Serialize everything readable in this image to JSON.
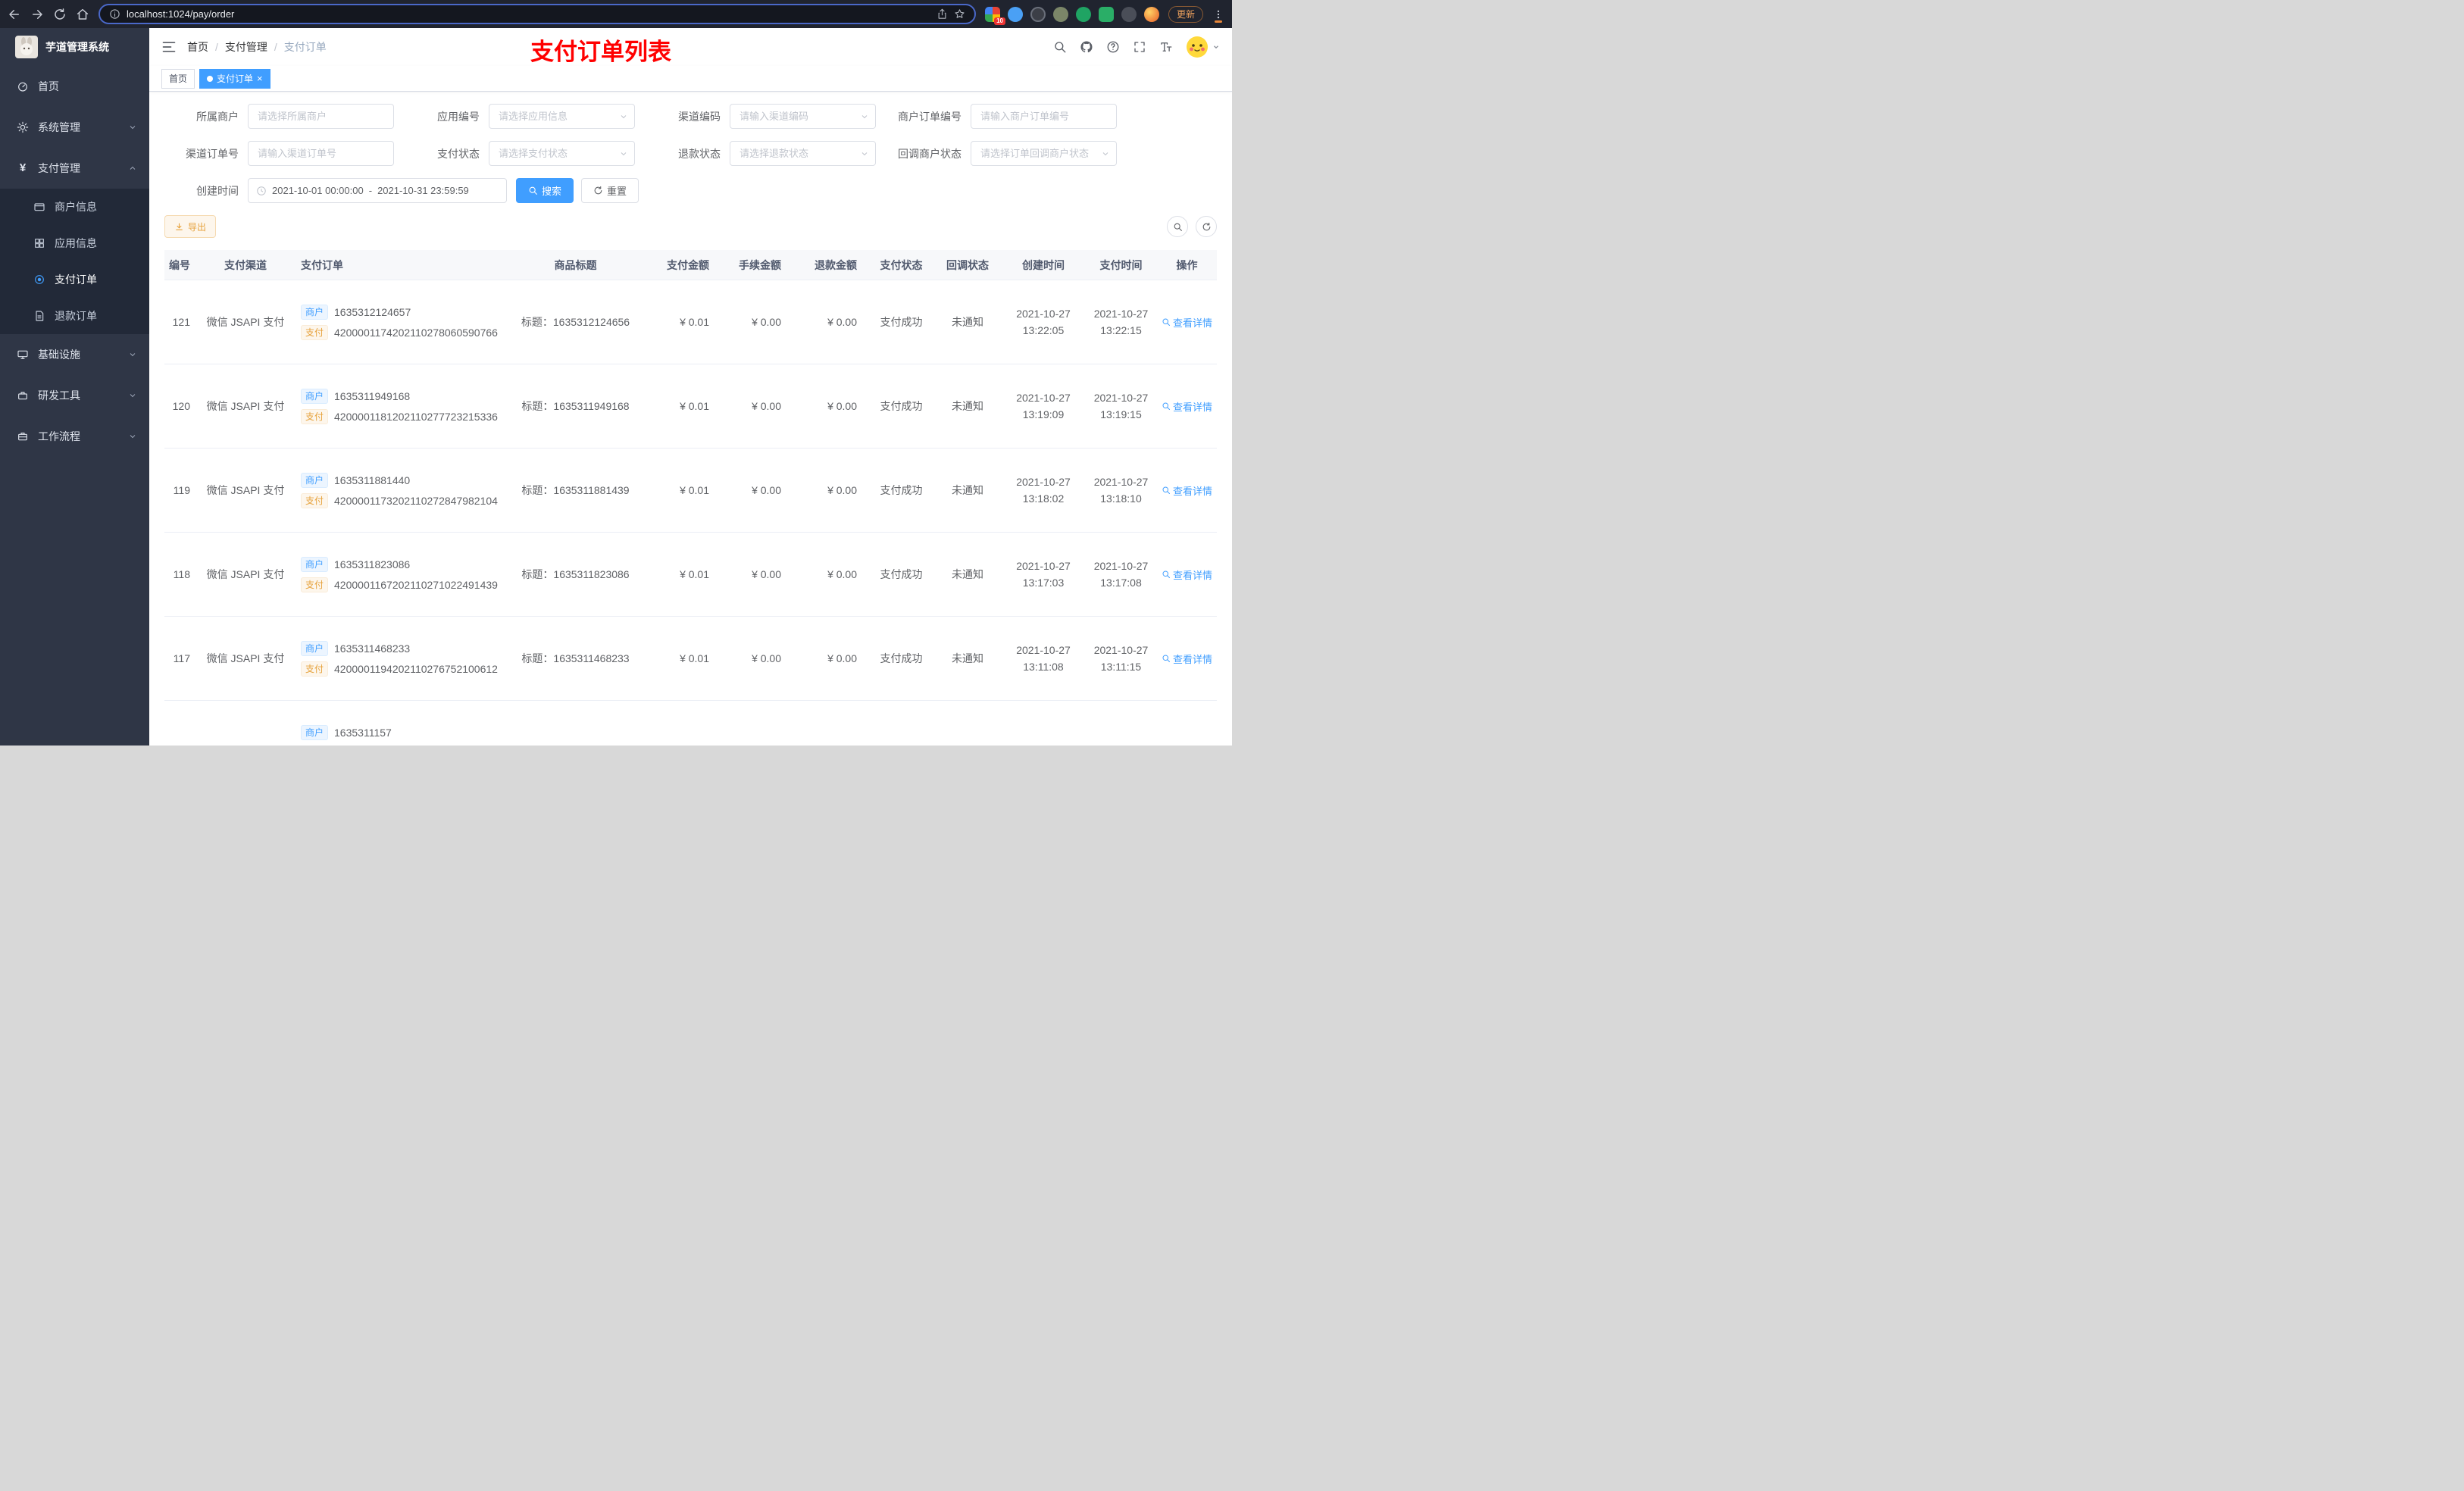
{
  "browser": {
    "url": "localhost:1024/pay/order",
    "update_label": "更新",
    "extension_badge": "10"
  },
  "sidebar": {
    "title": "芋道管理系统",
    "items": [
      {
        "label": "首页"
      },
      {
        "label": "系统管理"
      },
      {
        "label": "支付管理",
        "children": [
          {
            "label": "商户信息"
          },
          {
            "label": "应用信息"
          },
          {
            "label": "支付订单",
            "active": true
          },
          {
            "label": "退款订单"
          }
        ]
      },
      {
        "label": "基础设施"
      },
      {
        "label": "研发工具"
      },
      {
        "label": "工作流程"
      }
    ]
  },
  "header": {
    "breadcrumb": [
      "首页",
      "支付管理",
      "支付订单"
    ],
    "annotation": "支付订单列表"
  },
  "tabs": {
    "items": [
      {
        "label": "首页",
        "active": false
      },
      {
        "label": "支付订单",
        "active": true
      }
    ]
  },
  "filters": {
    "fields": [
      {
        "label": "所属商户",
        "placeholder": "请选择所属商户"
      },
      {
        "label": "应用编号",
        "placeholder": "请选择应用信息"
      },
      {
        "label": "渠道编码",
        "placeholder": "请输入渠道编码"
      },
      {
        "label": "商户订单编号",
        "placeholder": "请输入商户订单编号"
      },
      {
        "label": "渠道订单号",
        "placeholder": "请输入渠道订单号"
      },
      {
        "label": "支付状态",
        "placeholder": "请选择支付状态"
      },
      {
        "label": "退款状态",
        "placeholder": "请选择退款状态"
      },
      {
        "label": "回调商户状态",
        "placeholder": "请选择订单回调商户状态"
      }
    ],
    "date": {
      "label": "创建时间",
      "start": "2021-10-01 00:00:00",
      "separator": "-",
      "end": "2021-10-31 23:59:59"
    },
    "search_label": "搜索",
    "reset_label": "重置"
  },
  "toolbar": {
    "export_label": "导出"
  },
  "table": {
    "columns": [
      "编号",
      "支付渠道",
      "支付订单",
      "商品标题",
      "支付金额",
      "手续金额",
      "退款金额",
      "支付状态",
      "回调状态",
      "创建时间",
      "支付时间",
      "操作"
    ],
    "merchant_tag": "商户",
    "pay_tag": "支付",
    "title_prefix": "标题：",
    "action_label": "查看详情",
    "rows": [
      {
        "id": "121",
        "channel": "微信 JSAPI 支付",
        "merchant_no": "1635312124657",
        "pay_no": "4200001174202110278060590766",
        "title": "1635312124656",
        "pay_amount": "¥ 0.01",
        "fee_amount": "¥ 0.00",
        "refund_amount": "¥ 0.00",
        "pay_status": "支付成功",
        "notify_status": "未通知",
        "create_date": "2021-10-27",
        "create_time": "13:22:05",
        "pay_date": "2021-10-27",
        "pay_time": "13:22:15"
      },
      {
        "id": "120",
        "channel": "微信 JSAPI 支付",
        "merchant_no": "1635311949168",
        "pay_no": "4200001181202110277723215336",
        "title": "1635311949168",
        "pay_amount": "¥ 0.01",
        "fee_amount": "¥ 0.00",
        "refund_amount": "¥ 0.00",
        "pay_status": "支付成功",
        "notify_status": "未通知",
        "create_date": "2021-10-27",
        "create_time": "13:19:09",
        "pay_date": "2021-10-27",
        "pay_time": "13:19:15"
      },
      {
        "id": "119",
        "channel": "微信 JSAPI 支付",
        "merchant_no": "1635311881440",
        "pay_no": "4200001173202110272847982104",
        "title": "1635311881439",
        "pay_amount": "¥ 0.01",
        "fee_amount": "¥ 0.00",
        "refund_amount": "¥ 0.00",
        "pay_status": "支付成功",
        "notify_status": "未通知",
        "create_date": "2021-10-27",
        "create_time": "13:18:02",
        "pay_date": "2021-10-27",
        "pay_time": "13:18:10"
      },
      {
        "id": "118",
        "channel": "微信 JSAPI 支付",
        "merchant_no": "1635311823086",
        "pay_no": "4200001167202110271022491439",
        "title": "1635311823086",
        "pay_amount": "¥ 0.01",
        "fee_amount": "¥ 0.00",
        "refund_amount": "¥ 0.00",
        "pay_status": "支付成功",
        "notify_status": "未通知",
        "create_date": "2021-10-27",
        "create_time": "13:17:03",
        "pay_date": "2021-10-27",
        "pay_time": "13:17:08"
      },
      {
        "id": "117",
        "channel": "微信 JSAPI 支付",
        "merchant_no": "1635311468233",
        "pay_no": "4200001194202110276752100612",
        "title": "1635311468233",
        "pay_amount": "¥ 0.01",
        "fee_amount": "¥ 0.00",
        "refund_amount": "¥ 0.00",
        "pay_status": "支付成功",
        "notify_status": "未通知",
        "create_date": "2021-10-27",
        "create_time": "13:11:08",
        "pay_date": "2021-10-27",
        "pay_time": "13:11:15"
      },
      {
        "merchant_no": "1635311157"
      }
    ]
  },
  "colors": {
    "primary": "#409eff",
    "warning": "#e6a23c",
    "annotation_red": "#ff0000",
    "sidebar_bg": "#2f3646",
    "active_tab_bg": "#409eff"
  }
}
